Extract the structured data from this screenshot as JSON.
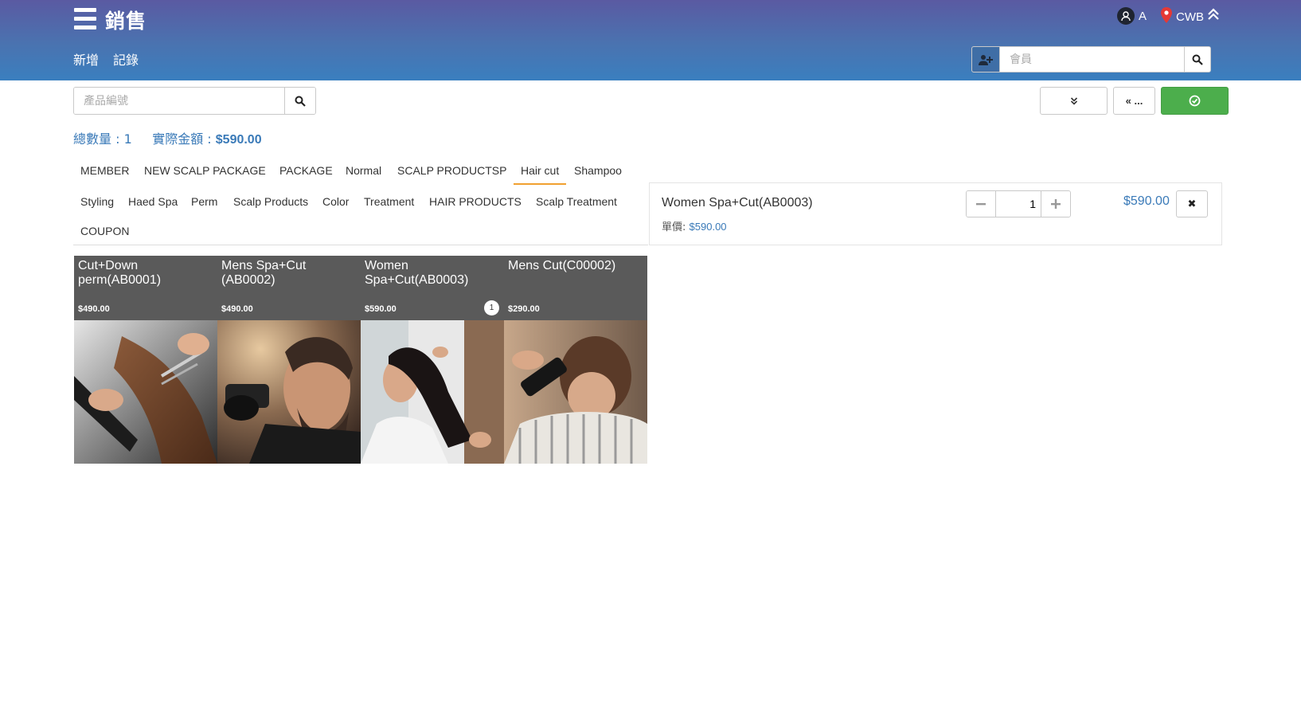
{
  "header": {
    "title": "銷售",
    "user_name": "A",
    "location": "CWB",
    "nav": [
      {
        "label": "新增"
      },
      {
        "label": "記錄"
      }
    ],
    "member_search_placeholder": "會員"
  },
  "toolbar": {
    "product_search_placeholder": "產品編號",
    "back_label": "« ...",
    "confirm_color": "#4cae4c"
  },
  "summary": {
    "quantity_label": "總數量 : 1",
    "amount_label": "實際金額 :",
    "amount_value": "$590.00"
  },
  "categories": [
    {
      "label": "MEMBER"
    },
    {
      "label": "NEW SCALP PACKAGE"
    },
    {
      "label": "PACKAGE"
    },
    {
      "label": "Normal"
    },
    {
      "label": "SCALP PRODUCTSP"
    },
    {
      "label": "Hair cut",
      "active": true
    },
    {
      "label": "Shampoo"
    },
    {
      "label": "Styling"
    },
    {
      "label": "Haed Spa"
    },
    {
      "label": "Perm"
    },
    {
      "label": "Scalp Products"
    },
    {
      "label": "Color"
    },
    {
      "label": "Treatment"
    },
    {
      "label": "HAIR PRODUCTS"
    },
    {
      "label": "Scalp Treatment"
    },
    {
      "label": "COUPON"
    }
  ],
  "products": [
    {
      "name": "Cut+Down perm(AB0001)",
      "price": "$490.00",
      "badge": ""
    },
    {
      "name": "Mens Spa+Cut (AB0002)",
      "price": "$490.00",
      "badge": ""
    },
    {
      "name": "Women Spa+Cut(AB0003)",
      "price": "$590.00",
      "badge": "1"
    },
    {
      "name": "Mens Cut(C00002)",
      "price": "$290.00",
      "badge": ""
    }
  ],
  "cart": {
    "item_name": "Women Spa+Cut(AB0003)",
    "unit_label": "單價:",
    "unit_price": "$590.00",
    "quantity": "1",
    "total": "$590.00",
    "remove_label": "✖"
  },
  "colors": {
    "header_top": "#5a5aa2",
    "header_bottom": "#3a7fbf",
    "accent_blue": "#3a7ab8",
    "active_tab": "#f0a030",
    "tile_header": "#5a5a5a"
  }
}
